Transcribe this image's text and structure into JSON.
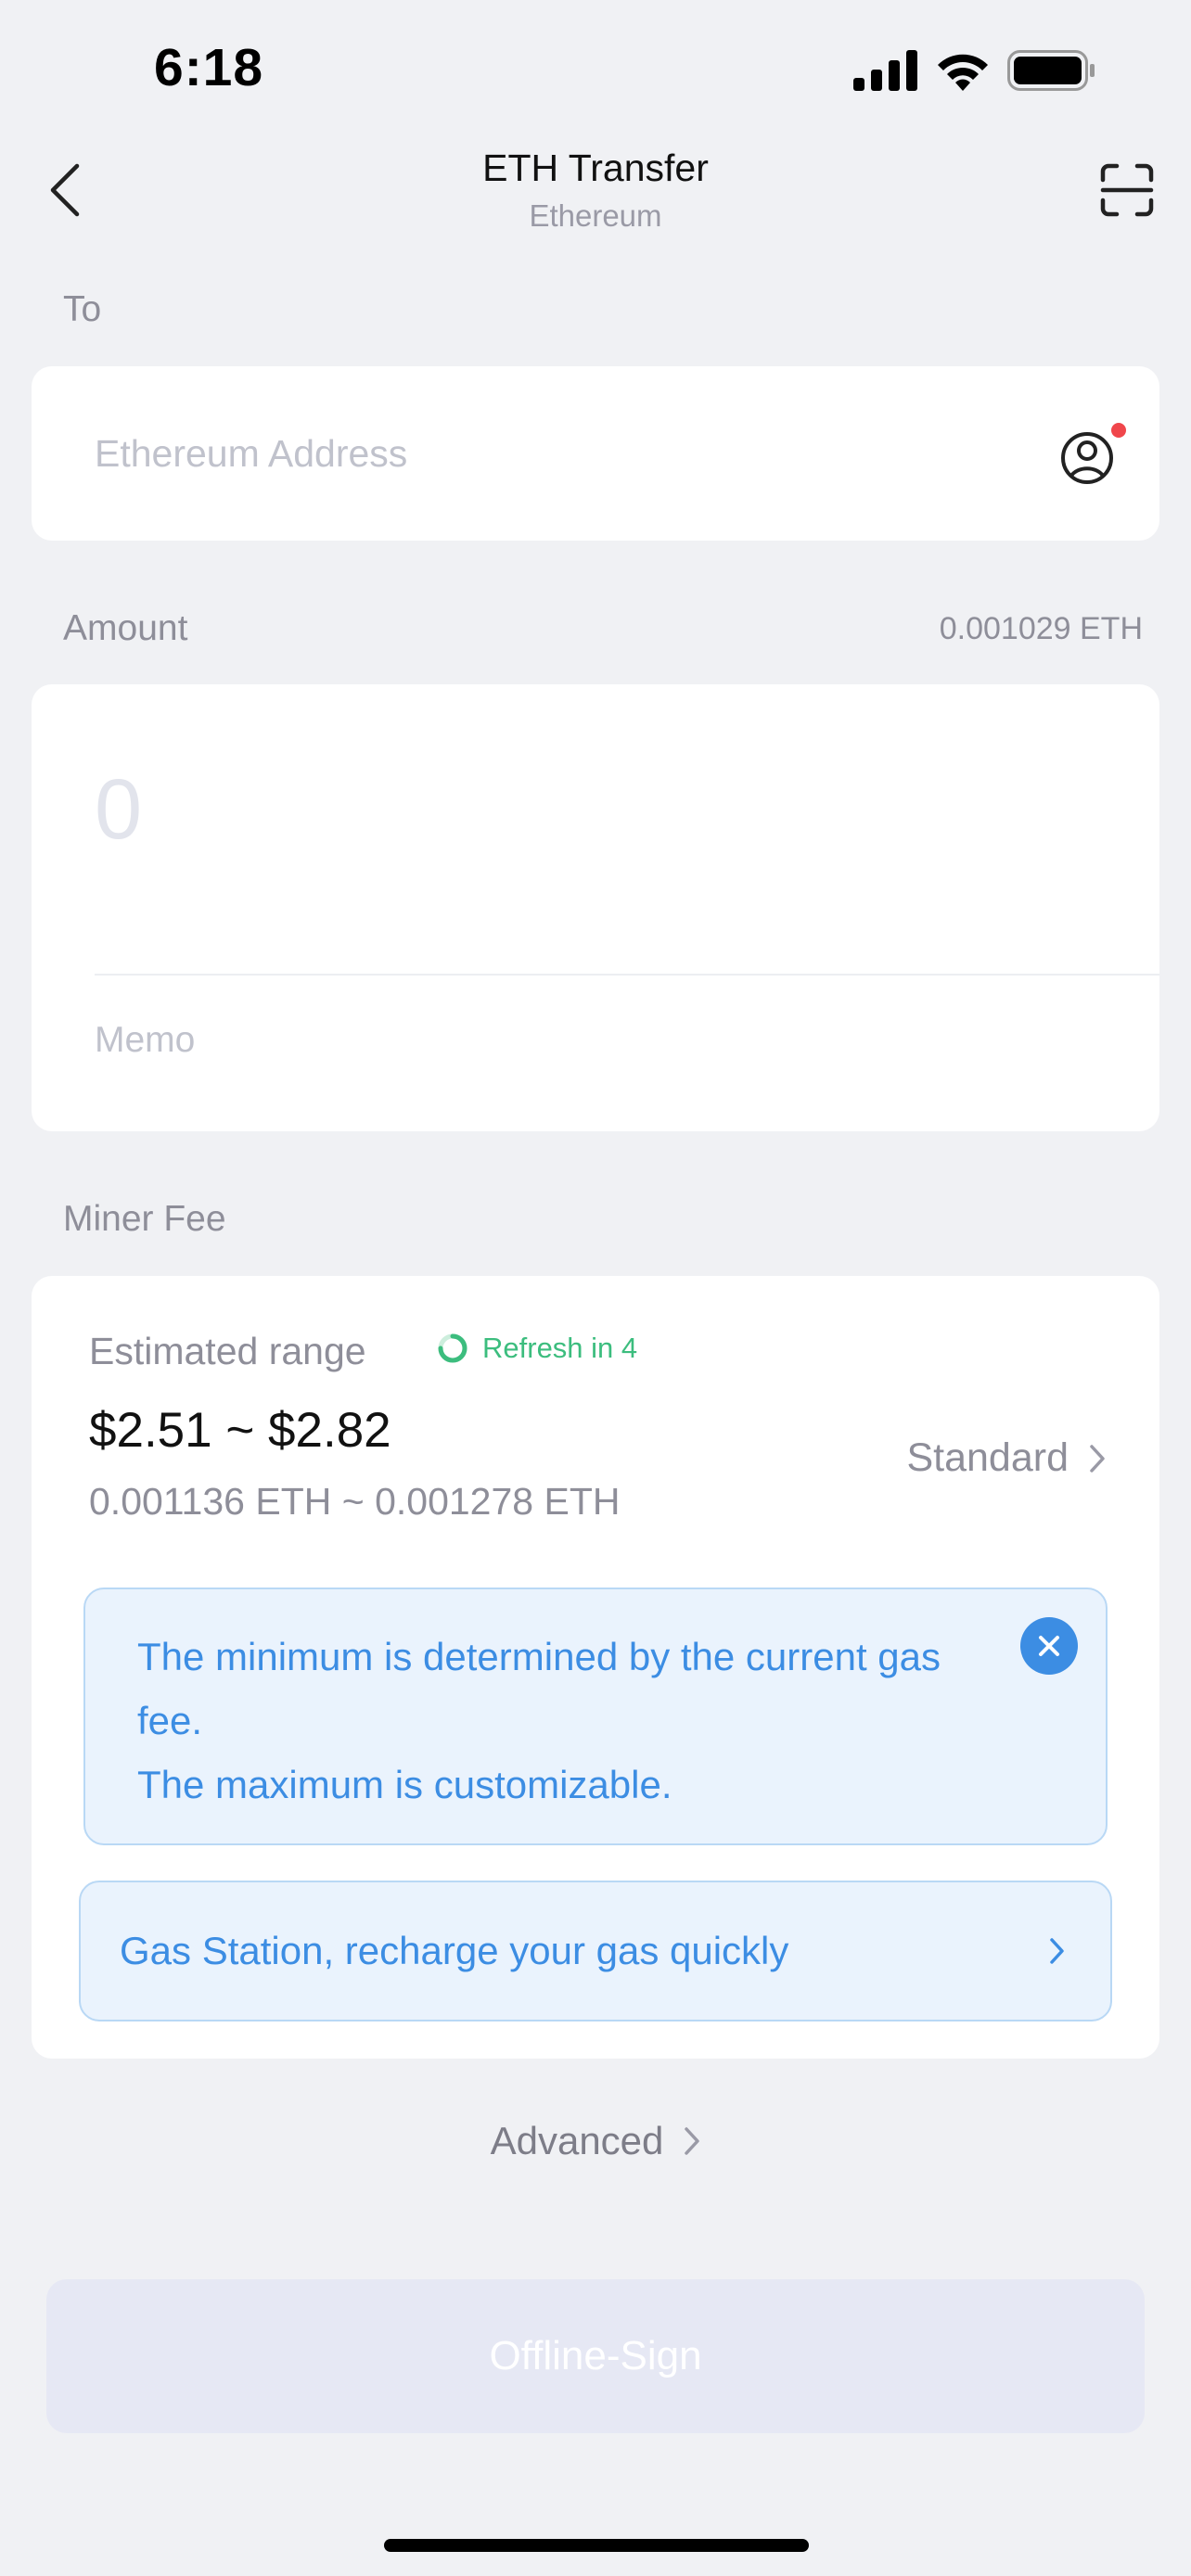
{
  "status_bar": {
    "time": "6:18"
  },
  "nav": {
    "title": "ETH Transfer",
    "subtitle": "Ethereum"
  },
  "to": {
    "label": "To",
    "placeholder": "Ethereum Address"
  },
  "amount": {
    "label": "Amount",
    "balance": "0.001029 ETH",
    "placeholder": "0",
    "memo_placeholder": "Memo"
  },
  "miner_fee": {
    "label": "Miner Fee",
    "estimated_label": "Estimated range",
    "refresh_text": "Refresh in 4",
    "usd_range": "$2.51 ~ $2.82",
    "eth_range": "0.001136 ETH ~ 0.001278 ETH",
    "speed": "Standard",
    "info_line1": "The minimum is determined by the current gas fee.",
    "info_line2": "The maximum is customizable.",
    "gas_station": "Gas Station, recharge your gas quickly"
  },
  "advanced_label": "Advanced",
  "offline_sign_label": "Offline-Sign",
  "colors": {
    "accent_blue": "#3c8de3",
    "accent_green": "#3cbd7e",
    "notify_red": "#f0464b"
  },
  "icons": [
    "back-chevron-icon",
    "scan-icon",
    "contact-icon",
    "refresh-spinner-icon",
    "chevron-right-icon",
    "close-icon",
    "signal-icon",
    "wifi-icon",
    "battery-icon"
  ]
}
